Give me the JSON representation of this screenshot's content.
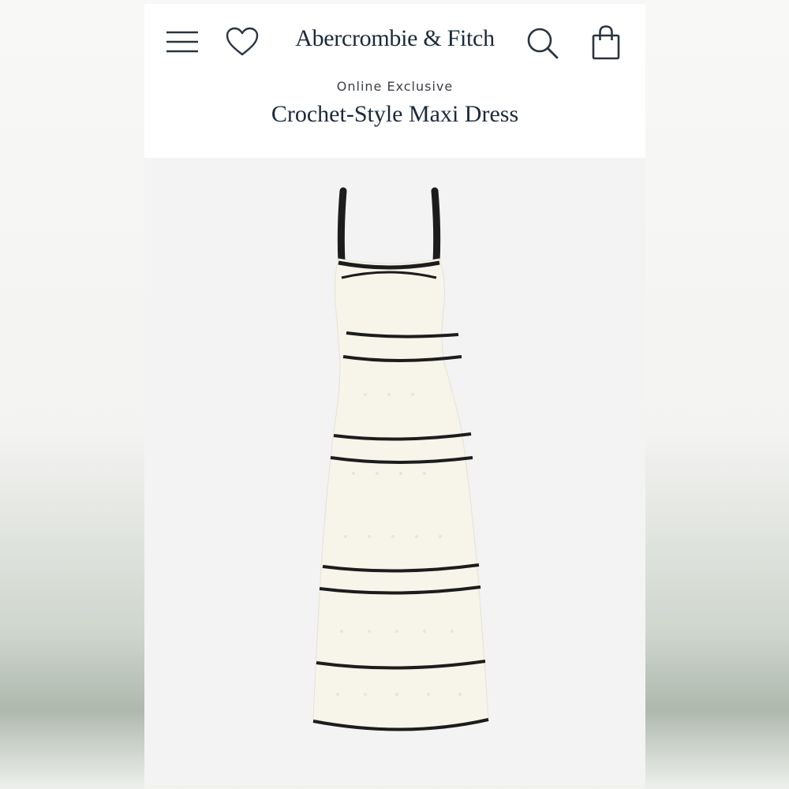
{
  "header": {
    "brand": "Abercrombie & Fitch",
    "menu_icon": "hamburger-menu-icon",
    "wishlist_icon": "heart-icon",
    "search_icon": "search-icon",
    "bag_icon": "shopping-bag-icon"
  },
  "product": {
    "badge": "Online Exclusive",
    "title": "Crochet-Style Maxi Dress"
  },
  "colors": {
    "brand_text": "#1b2a3b",
    "dress_body": "#f7f4ea",
    "dress_trim": "#1c1c1c",
    "image_bg": "#f3f3f3"
  }
}
